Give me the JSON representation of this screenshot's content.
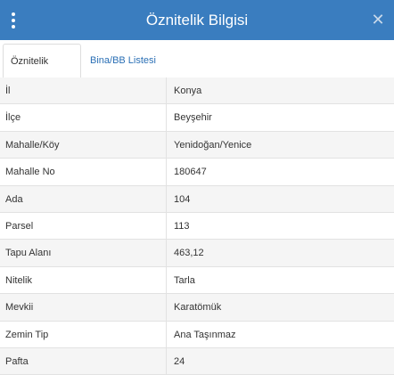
{
  "header": {
    "title": "Öznitelik Bilgisi",
    "close_glyph": "✕",
    "color": "#3a7dbf"
  },
  "tabs": [
    {
      "label": "Öznitelik Bilgisi",
      "active": true
    },
    {
      "label": "Bina/BB Listesi",
      "active": false
    }
  ],
  "rows": [
    {
      "label": "İl",
      "value": "Konya"
    },
    {
      "label": "İlçe",
      "value": "Beyşehir"
    },
    {
      "label": "Mahalle/Köy",
      "value": "Yenidoğan/Yenice"
    },
    {
      "label": "Mahalle No",
      "value": "180647"
    },
    {
      "label": "Ada",
      "value": "104"
    },
    {
      "label": "Parsel",
      "value": "113"
    },
    {
      "label": "Tapu Alanı",
      "value": "463,12"
    },
    {
      "label": "Nitelik",
      "value": "Tarla"
    },
    {
      "label": "Mevkii",
      "value": "Karatömük"
    },
    {
      "label": "Zemin Tip",
      "value": "Ana Taşınmaz"
    },
    {
      "label": "Pafta",
      "value": "24"
    }
  ]
}
